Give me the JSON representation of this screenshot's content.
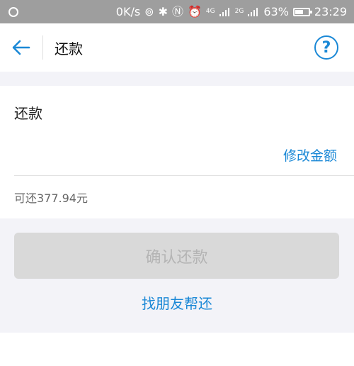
{
  "status_bar": {
    "speed": "0K/s",
    "net_type_1": "4G",
    "net_type_2": "2G",
    "battery_percent": "63%",
    "battery_level": 0.63,
    "time": "23:29"
  },
  "nav": {
    "title": "还款",
    "help_symbol": "?"
  },
  "form": {
    "label": "还款",
    "amount_value": "",
    "modify_label": "修改金额",
    "available_text": "可还377.94元"
  },
  "actions": {
    "confirm_label": "确认还款",
    "friend_label": "找朋友帮还"
  },
  "colors": {
    "accent": "#1a88d6",
    "status_bar": "#9e9e9e",
    "disabled_button": "#d9d9d9",
    "page_bg": "#f3f3f8"
  }
}
